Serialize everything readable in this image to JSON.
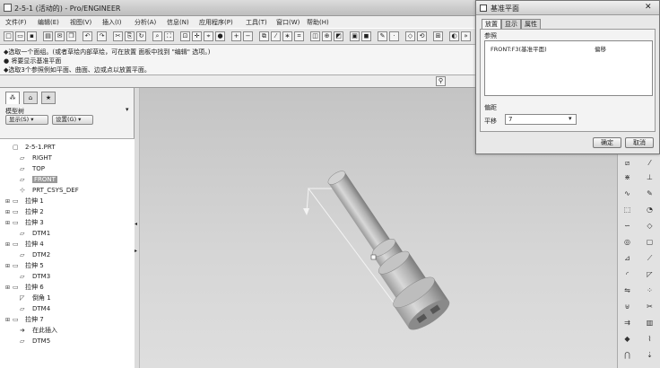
{
  "window": {
    "title": "2-5-1 (活动的) - Pro/ENGINEER"
  },
  "menu": [
    "文件(F)",
    "编辑(E)",
    "视图(V)",
    "插入(I)",
    "分析(A)",
    "信息(N)",
    "应用程序(P)",
    "工具(T)",
    "窗口(W)",
    "帮助(H)"
  ],
  "messages": [
    "◆选取一个面组。(或者草绘内部草绘，可在放置 面板中找到 \"编辑\" 选项。)",
    "● 将要显示基准平面",
    "◆选取3个参照例如平面、曲面、边或点以放置平面。"
  ],
  "panel": {
    "tabs": [
      "模型树",
      "文件夹",
      "收藏夹"
    ],
    "tree_label": "模型树",
    "show_button": "显示(S)",
    "settings_button": "设置(G)"
  },
  "tree": [
    {
      "expander": "",
      "icon": "part-icon",
      "label": "2-5-1.PRT",
      "indent": 0,
      "selected": false
    },
    {
      "expander": "",
      "icon": "datum-plane-icon",
      "label": "RIGHT",
      "indent": 1,
      "selected": false
    },
    {
      "expander": "",
      "icon": "datum-plane-icon",
      "label": "TOP",
      "indent": 1,
      "selected": false
    },
    {
      "expander": "",
      "icon": "datum-plane-icon",
      "label": "FRONT",
      "indent": 1,
      "selected": true
    },
    {
      "expander": "",
      "icon": "csys-icon",
      "label": "PRT_CSYS_DEF",
      "indent": 1,
      "selected": false
    },
    {
      "expander": "+",
      "icon": "extrude-icon",
      "label": "拉伸 1",
      "indent": 0,
      "selected": false
    },
    {
      "expander": "+",
      "icon": "extrude-icon",
      "label": "拉伸 2",
      "indent": 0,
      "selected": false
    },
    {
      "expander": "+",
      "icon": "extrude-icon",
      "label": "拉伸 3",
      "indent": 0,
      "selected": false
    },
    {
      "expander": "",
      "icon": "datum-plane-icon",
      "label": "DTM1",
      "indent": 1,
      "selected": false
    },
    {
      "expander": "+",
      "icon": "extrude-icon",
      "label": "拉伸 4",
      "indent": 0,
      "selected": false
    },
    {
      "expander": "",
      "icon": "datum-plane-icon",
      "label": "DTM2",
      "indent": 1,
      "selected": false
    },
    {
      "expander": "+",
      "icon": "extrude-icon",
      "label": "拉伸 5",
      "indent": 0,
      "selected": false
    },
    {
      "expander": "",
      "icon": "datum-plane-icon",
      "label": "DTM3",
      "indent": 1,
      "selected": false
    },
    {
      "expander": "+",
      "icon": "extrude-icon",
      "label": "拉伸 6",
      "indent": 0,
      "selected": false
    },
    {
      "expander": "",
      "icon": "chamfer-icon",
      "label": "倒角 1",
      "indent": 1,
      "selected": false
    },
    {
      "expander": "",
      "icon": "datum-plane-icon",
      "label": "DTM4",
      "indent": 1,
      "selected": false
    },
    {
      "expander": "+",
      "icon": "extrude-icon",
      "label": "拉伸 7",
      "indent": 0,
      "selected": false
    },
    {
      "expander": "",
      "icon": "insert-here-icon",
      "label": "在此插入",
      "indent": 1,
      "selected": false
    },
    {
      "expander": "",
      "icon": "datum-plane-icon",
      "label": "DTM5",
      "indent": 1,
      "selected": false
    }
  ],
  "dialog": {
    "title": "基准平面",
    "tabs": [
      "放置",
      "显示",
      "属性"
    ],
    "references_label": "参照",
    "reference_item": "FRONT:F3(基准平面)",
    "reference_constraint": "偏移",
    "translation_label": "偏距",
    "offset_label": "平移",
    "offset_value": "7",
    "ok_button": "确定",
    "cancel_button": "取消"
  }
}
